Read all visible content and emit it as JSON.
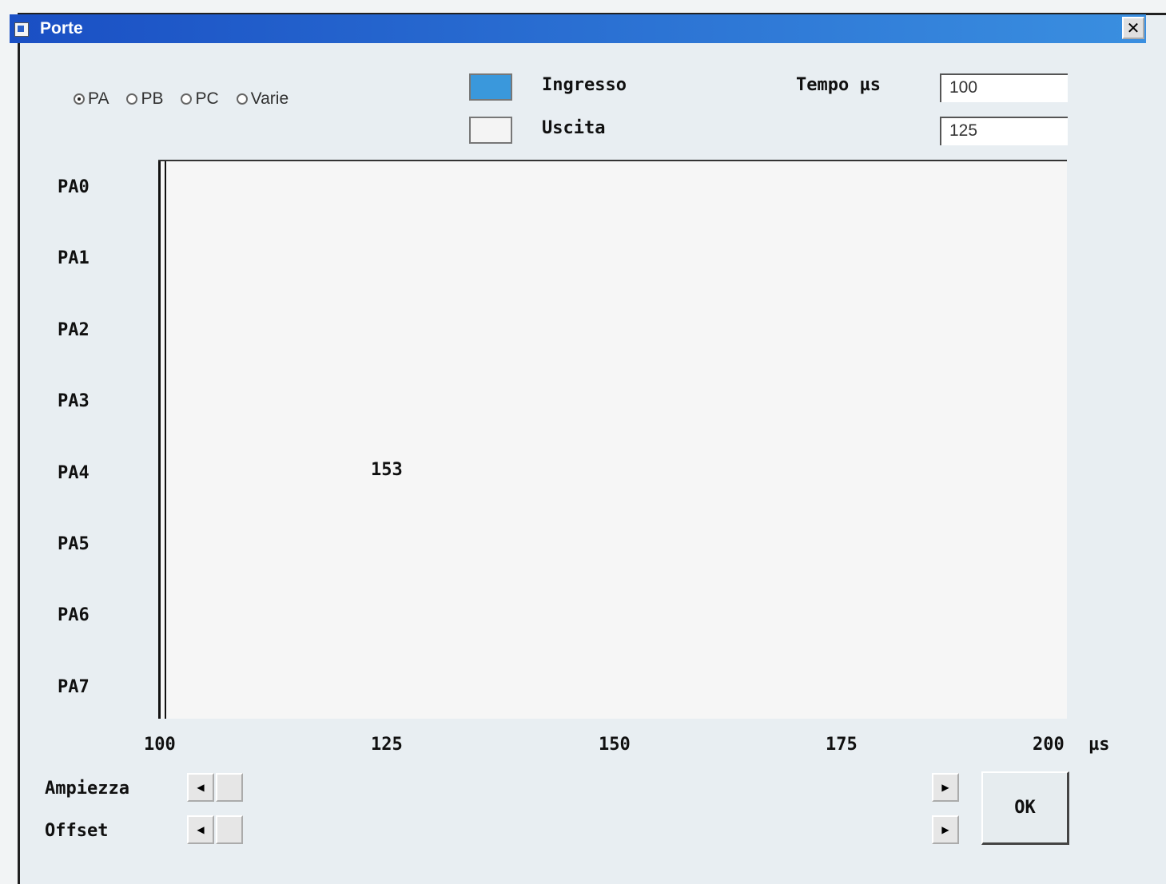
{
  "window": {
    "title": "Porte",
    "close_glyph": "✕"
  },
  "port_selector": {
    "options": [
      {
        "label": "PA",
        "selected": true
      },
      {
        "label": "PB",
        "selected": false
      },
      {
        "label": "PC",
        "selected": false
      },
      {
        "label": "Varie",
        "selected": false
      }
    ]
  },
  "legend": {
    "input_label": "Ingresso",
    "input_color": "#3a98dc",
    "output_label": "Uscita",
    "output_color": "#f4f4f4"
  },
  "time": {
    "label": "Tempo µs",
    "start_value": "100",
    "end_value": "125"
  },
  "plot": {
    "channels": [
      "PA0",
      "PA1",
      "PA2",
      "PA3",
      "PA4",
      "PA5",
      "PA6",
      "PA7"
    ],
    "x_ticks": [
      "100",
      "125",
      "150",
      "175",
      "200"
    ],
    "x_unit": "µs",
    "marker_value": "153"
  },
  "controls": {
    "amplitude_label": "Ampiezza",
    "offset_label": "Offset",
    "ok_label": "OK",
    "left_arrow": "◀",
    "right_arrow": "▶"
  }
}
